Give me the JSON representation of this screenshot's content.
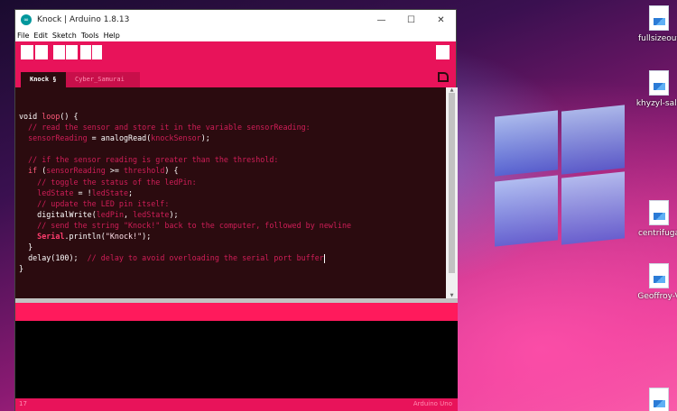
{
  "window": {
    "title": "Knock | Arduino 1.8.13",
    "app_icon": "arduino-logo-icon",
    "controls": {
      "minimize": "—",
      "maximize": "☐",
      "close": "✕"
    }
  },
  "menubar": {
    "items": [
      "File",
      "Edit",
      "Sketch",
      "Tools",
      "Help"
    ]
  },
  "tabs": [
    {
      "label": "Knock §",
      "active": true
    },
    {
      "label": "Cyber_Samurai §",
      "active": false
    }
  ],
  "editor": {
    "lines": [
      [
        {
          "t": "void ",
          "c": "plain"
        },
        {
          "t": "loop",
          "c": "kw"
        },
        {
          "t": "() {",
          "c": "plain"
        }
      ],
      [
        {
          "t": "  // read the sensor and store it in the variable sensorReading:",
          "c": "cm"
        }
      ],
      [
        {
          "t": "  sensorReading",
          "c": "var"
        },
        {
          "t": " = ",
          "c": "plain"
        },
        {
          "t": "analogRead",
          "c": "fn"
        },
        {
          "t": "(",
          "c": "plain"
        },
        {
          "t": "knockSensor",
          "c": "var"
        },
        {
          "t": ");",
          "c": "plain"
        }
      ],
      [
        {
          "t": "",
          "c": "plain"
        }
      ],
      [
        {
          "t": "  // if the sensor reading is greater than the threshold:",
          "c": "cm"
        }
      ],
      [
        {
          "t": "  ",
          "c": "plain"
        },
        {
          "t": "if",
          "c": "kw"
        },
        {
          "t": " (",
          "c": "plain"
        },
        {
          "t": "sensorReading",
          "c": "var"
        },
        {
          "t": " >= ",
          "c": "plain"
        },
        {
          "t": "threshold",
          "c": "var"
        },
        {
          "t": ") {",
          "c": "plain"
        }
      ],
      [
        {
          "t": "    // toggle the status of the ledPin:",
          "c": "cm"
        }
      ],
      [
        {
          "t": "    ledState",
          "c": "var"
        },
        {
          "t": " = !",
          "c": "plain"
        },
        {
          "t": "ledState",
          "c": "var"
        },
        {
          "t": ";",
          "c": "plain"
        }
      ],
      [
        {
          "t": "    // update the LED pin itself:",
          "c": "cm"
        }
      ],
      [
        {
          "t": "    ",
          "c": "plain"
        },
        {
          "t": "digitalWrite",
          "c": "fn"
        },
        {
          "t": "(",
          "c": "plain"
        },
        {
          "t": "ledPin",
          "c": "var"
        },
        {
          "t": ", ",
          "c": "plain"
        },
        {
          "t": "ledState",
          "c": "var"
        },
        {
          "t": ");",
          "c": "plain"
        }
      ],
      [
        {
          "t": "    // send the string \"Knock!\" back to the computer, followed by newline",
          "c": "cm"
        }
      ],
      [
        {
          "t": "    ",
          "c": "plain"
        },
        {
          "t": "Serial",
          "c": "obj"
        },
        {
          "t": ".println(",
          "c": "plain"
        },
        {
          "t": "\"Knock!\"",
          "c": "str"
        },
        {
          "t": ");",
          "c": "plain"
        }
      ],
      [
        {
          "t": "  }",
          "c": "plain"
        }
      ],
      [
        {
          "t": "  delay(100);  ",
          "c": "plain"
        },
        {
          "t": "// delay to avoid overloading the serial port buffer",
          "c": "cm"
        }
      ],
      [
        {
          "t": "}",
          "c": "plain"
        }
      ]
    ]
  },
  "statusbar": {
    "line": "17",
    "board": "Arduino Uno"
  },
  "desktop": {
    "icons": [
      {
        "label": "fullsizeout"
      },
      {
        "label": "khyzyl-sale"
      },
      {
        "label": "centrifuga"
      },
      {
        "label": "Geoffroy-V"
      },
      {
        "label": ""
      }
    ]
  },
  "colors": {
    "accent": "#e8135a",
    "editor_bg": "#2b0b0f",
    "comment": "#d01e58",
    "keyword": "#ff5a7a"
  }
}
